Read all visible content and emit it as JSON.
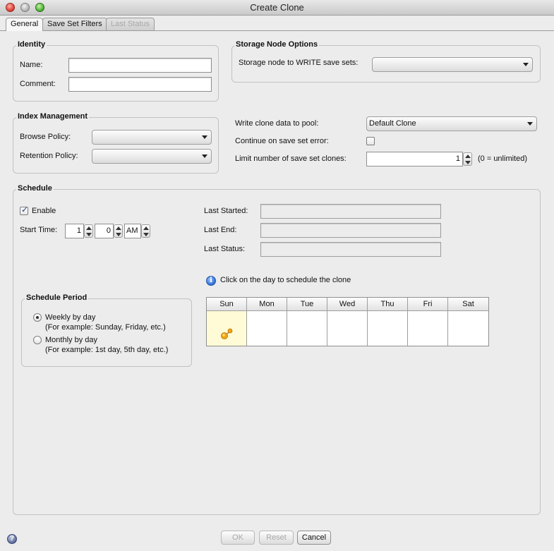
{
  "window": {
    "title": "Create Clone"
  },
  "tabs": [
    {
      "label": "General",
      "state": "active"
    },
    {
      "label": "Save Set Filters",
      "state": "normal"
    },
    {
      "label": "Last Status",
      "state": "disabled"
    }
  ],
  "identity": {
    "title": "Identity",
    "name_label": "Name:",
    "name_value": "",
    "comment_label": "Comment:",
    "comment_value": ""
  },
  "storage_node": {
    "title": "Storage Node Options",
    "write_label": "Storage node to WRITE save sets:",
    "write_value": ""
  },
  "index_management": {
    "title": "Index Management",
    "browse_label": "Browse Policy:",
    "browse_value": "",
    "retention_label": "Retention Policy:",
    "retention_value": ""
  },
  "pool": {
    "label": "Write clone data to pool:",
    "value": "Default Clone",
    "continue_label": "Continue on save set error:",
    "continue_checked": false,
    "limit_label": "Limit number of save set clones:",
    "limit_value": "1",
    "limit_hint": "(0 = unlimited)"
  },
  "schedule": {
    "title": "Schedule",
    "enable_label": "Enable",
    "enable_checked": true,
    "start_time_label": "Start Time:",
    "hour": "1",
    "minute": "0",
    "ampm": "AM",
    "last_started_label": "Last Started:",
    "last_started_value": "",
    "last_end_label": "Last End:",
    "last_end_value": "",
    "last_status_label": "Last Status:",
    "last_status_value": "",
    "info_text": "Click on the day to schedule the clone",
    "days": [
      "Sun",
      "Mon",
      "Tue",
      "Wed",
      "Thu",
      "Fri",
      "Sat"
    ],
    "selected_day": "Sun"
  },
  "schedule_period": {
    "title": "Schedule Period",
    "weekly_label": "Weekly by day",
    "weekly_example": "(For example: Sunday, Friday, etc.)",
    "monthly_label": "Monthly by day",
    "monthly_example": "(For example: 1st day, 5th day, etc.)",
    "selected": "weekly"
  },
  "buttons": {
    "ok": "OK",
    "reset": "Reset",
    "cancel": "Cancel"
  },
  "icons": {
    "info": "info-icon",
    "help": "help-icon",
    "schedule_marker": "clone-schedule-icon"
  },
  "colors": {
    "selected_day_bg": "#fffbd6",
    "info_blue": "#2d6fd6"
  }
}
